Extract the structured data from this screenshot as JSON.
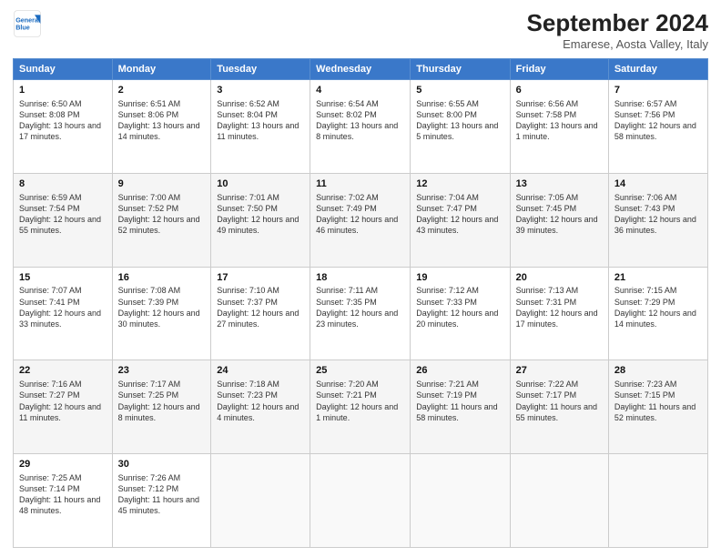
{
  "header": {
    "logo_line1": "General",
    "logo_line2": "Blue",
    "main_title": "September 2024",
    "subtitle": "Emarese, Aosta Valley, Italy"
  },
  "columns": [
    "Sunday",
    "Monday",
    "Tuesday",
    "Wednesday",
    "Thursday",
    "Friday",
    "Saturday"
  ],
  "weeks": [
    [
      {
        "day": "1",
        "sunrise": "6:50 AM",
        "sunset": "8:08 PM",
        "daylight": "13 hours and 17 minutes."
      },
      {
        "day": "2",
        "sunrise": "6:51 AM",
        "sunset": "8:06 PM",
        "daylight": "13 hours and 14 minutes."
      },
      {
        "day": "3",
        "sunrise": "6:52 AM",
        "sunset": "8:04 PM",
        "daylight": "13 hours and 11 minutes."
      },
      {
        "day": "4",
        "sunrise": "6:54 AM",
        "sunset": "8:02 PM",
        "daylight": "13 hours and 8 minutes."
      },
      {
        "day": "5",
        "sunrise": "6:55 AM",
        "sunset": "8:00 PM",
        "daylight": "13 hours and 5 minutes."
      },
      {
        "day": "6",
        "sunrise": "6:56 AM",
        "sunset": "7:58 PM",
        "daylight": "13 hours and 1 minute."
      },
      {
        "day": "7",
        "sunrise": "6:57 AM",
        "sunset": "7:56 PM",
        "daylight": "12 hours and 58 minutes."
      }
    ],
    [
      {
        "day": "8",
        "sunrise": "6:59 AM",
        "sunset": "7:54 PM",
        "daylight": "12 hours and 55 minutes."
      },
      {
        "day": "9",
        "sunrise": "7:00 AM",
        "sunset": "7:52 PM",
        "daylight": "12 hours and 52 minutes."
      },
      {
        "day": "10",
        "sunrise": "7:01 AM",
        "sunset": "7:50 PM",
        "daylight": "12 hours and 49 minutes."
      },
      {
        "day": "11",
        "sunrise": "7:02 AM",
        "sunset": "7:49 PM",
        "daylight": "12 hours and 46 minutes."
      },
      {
        "day": "12",
        "sunrise": "7:04 AM",
        "sunset": "7:47 PM",
        "daylight": "12 hours and 43 minutes."
      },
      {
        "day": "13",
        "sunrise": "7:05 AM",
        "sunset": "7:45 PM",
        "daylight": "12 hours and 39 minutes."
      },
      {
        "day": "14",
        "sunrise": "7:06 AM",
        "sunset": "7:43 PM",
        "daylight": "12 hours and 36 minutes."
      }
    ],
    [
      {
        "day": "15",
        "sunrise": "7:07 AM",
        "sunset": "7:41 PM",
        "daylight": "12 hours and 33 minutes."
      },
      {
        "day": "16",
        "sunrise": "7:08 AM",
        "sunset": "7:39 PM",
        "daylight": "12 hours and 30 minutes."
      },
      {
        "day": "17",
        "sunrise": "7:10 AM",
        "sunset": "7:37 PM",
        "daylight": "12 hours and 27 minutes."
      },
      {
        "day": "18",
        "sunrise": "7:11 AM",
        "sunset": "7:35 PM",
        "daylight": "12 hours and 23 minutes."
      },
      {
        "day": "19",
        "sunrise": "7:12 AM",
        "sunset": "7:33 PM",
        "daylight": "12 hours and 20 minutes."
      },
      {
        "day": "20",
        "sunrise": "7:13 AM",
        "sunset": "7:31 PM",
        "daylight": "12 hours and 17 minutes."
      },
      {
        "day": "21",
        "sunrise": "7:15 AM",
        "sunset": "7:29 PM",
        "daylight": "12 hours and 14 minutes."
      }
    ],
    [
      {
        "day": "22",
        "sunrise": "7:16 AM",
        "sunset": "7:27 PM",
        "daylight": "12 hours and 11 minutes."
      },
      {
        "day": "23",
        "sunrise": "7:17 AM",
        "sunset": "7:25 PM",
        "daylight": "12 hours and 8 minutes."
      },
      {
        "day": "24",
        "sunrise": "7:18 AM",
        "sunset": "7:23 PM",
        "daylight": "12 hours and 4 minutes."
      },
      {
        "day": "25",
        "sunrise": "7:20 AM",
        "sunset": "7:21 PM",
        "daylight": "12 hours and 1 minute."
      },
      {
        "day": "26",
        "sunrise": "7:21 AM",
        "sunset": "7:19 PM",
        "daylight": "11 hours and 58 minutes."
      },
      {
        "day": "27",
        "sunrise": "7:22 AM",
        "sunset": "7:17 PM",
        "daylight": "11 hours and 55 minutes."
      },
      {
        "day": "28",
        "sunrise": "7:23 AM",
        "sunset": "7:15 PM",
        "daylight": "11 hours and 52 minutes."
      }
    ],
    [
      {
        "day": "29",
        "sunrise": "7:25 AM",
        "sunset": "7:14 PM",
        "daylight": "11 hours and 48 minutes."
      },
      {
        "day": "30",
        "sunrise": "7:26 AM",
        "sunset": "7:12 PM",
        "daylight": "11 hours and 45 minutes."
      },
      null,
      null,
      null,
      null,
      null
    ]
  ]
}
